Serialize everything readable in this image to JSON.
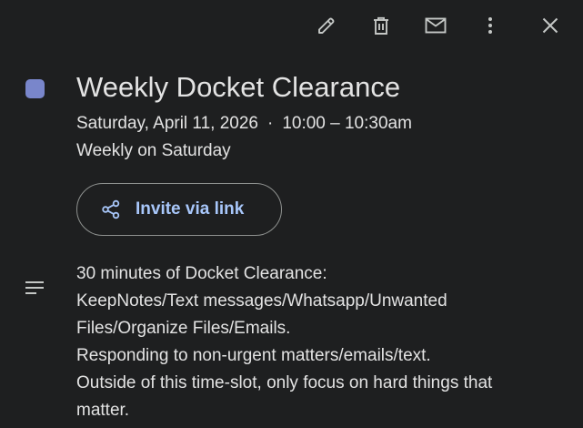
{
  "toolbar": {
    "edit_icon": "pencil-icon",
    "delete_icon": "trash-icon",
    "email_icon": "email-icon",
    "more_icon": "more-vert-icon",
    "close_icon": "close-icon",
    "icon_color": "#c4c7c5"
  },
  "event": {
    "color": "#7986cb",
    "title": "Weekly Docket Clearance",
    "date": "Saturday, April 11, 2026",
    "separator": "·",
    "time": "10:00 – 10:30am",
    "recurrence": "Weekly on Saturday"
  },
  "invite": {
    "icon": "share-icon",
    "label": "Invite via link",
    "accent_color": "#a8c7fa"
  },
  "description": {
    "icon": "notes-icon",
    "lines": [
      "30 minutes of Docket Clearance:",
      "KeepNotes/Text messages/Whatsapp/Unwanted",
      "Files/Organize Files/Emails.",
      "Responding to non-urgent matters/emails/text.",
      "Outside of this time-slot, only focus on hard things that",
      "matter."
    ]
  }
}
